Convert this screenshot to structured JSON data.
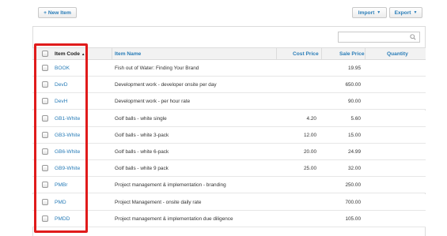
{
  "toolbar": {
    "new_item_label": "+ New Item",
    "import_label": "Import",
    "export_label": "Export"
  },
  "search": {
    "placeholder": ""
  },
  "table": {
    "columns": {
      "code": "Item Code",
      "name": "Item Name",
      "cost": "Cost Price",
      "sale": "Sale Price",
      "qty": "Quantity"
    },
    "rows": [
      {
        "code": "BOOK",
        "name": "Fish out of Water: Finding Your Brand",
        "cost": "",
        "sale": "19.95"
      },
      {
        "code": "DevD",
        "name": "Development work - developer onsite per day",
        "cost": "",
        "sale": "650.00"
      },
      {
        "code": "DevH",
        "name": "Development work - per hour rate",
        "cost": "",
        "sale": "90.00"
      },
      {
        "code": "GB1-White",
        "name": "Golf balls - white single",
        "cost": "4.20",
        "sale": "5.60"
      },
      {
        "code": "GB3-White",
        "name": "Golf balls - white 3-pack",
        "cost": "12.00",
        "sale": "15.00"
      },
      {
        "code": "GB6-White",
        "name": "Golf balls - white 6-pack",
        "cost": "20.00",
        "sale": "24.99"
      },
      {
        "code": "GB9-White",
        "name": "Golf balls - white 9 pack",
        "cost": "25.00",
        "sale": "32.00"
      },
      {
        "code": "PMBr",
        "name": "Project management & implementation - branding",
        "cost": "",
        "sale": "250.00"
      },
      {
        "code": "PMD",
        "name": "Project Management - onsite daily rate",
        "cost": "",
        "sale": "700.00"
      },
      {
        "code": "PMDD",
        "name": "Project management & implementation due diligence",
        "cost": "",
        "sale": "105.00"
      }
    ]
  },
  "colors": {
    "link": "#2a7db8",
    "highlight": "#e01b1b"
  }
}
